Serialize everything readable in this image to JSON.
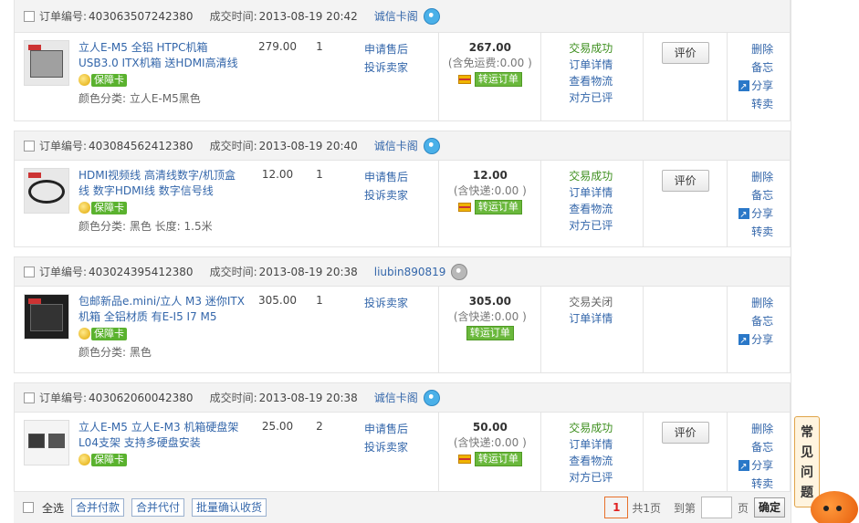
{
  "orders": [
    {
      "order_no_label": "订单编号:",
      "order_no": "403063507242380",
      "time_label": "成交时间:",
      "time": "2013-08-19 20:42",
      "seller": "诚信卡阁",
      "seller_online": true,
      "product": {
        "title": "立人E-M5 全铝 HTPC机箱 USB3.0 ITX机箱 送HDMI高清线",
        "badge": "保障卡",
        "attr": "颜色分类: 立人E-M5黑色"
      },
      "price": "279.00",
      "qty": "1",
      "service_links": [
        "申请售后",
        "投诉卖家"
      ],
      "total": "267.00",
      "shipping": "(含免运费:0.00 )",
      "convert_label": "转运订单",
      "status": "交易成功",
      "status_links": [
        "订单详情",
        "查看物流",
        "对方已评"
      ],
      "eval_label": "评价",
      "ops": [
        "删除",
        "备忘",
        "分享",
        "转卖"
      ]
    },
    {
      "order_no_label": "订单编号:",
      "order_no": "403084562412380",
      "time_label": "成交时间:",
      "time": "2013-08-19 20:40",
      "seller": "诚信卡阁",
      "seller_online": true,
      "product": {
        "title": "HDMI视频线 高清线数字/机顶盒线 数字HDMI线 数字信号线",
        "badge": "保障卡",
        "attr": "颜色分类: 黑色 长度: 1.5米"
      },
      "price": "12.00",
      "qty": "1",
      "service_links": [
        "申请售后",
        "投诉卖家"
      ],
      "total": "12.00",
      "shipping": "(含快递:0.00 )",
      "convert_label": "转运订单",
      "status": "交易成功",
      "status_links": [
        "订单详情",
        "查看物流",
        "对方已评"
      ],
      "eval_label": "评价",
      "ops": [
        "删除",
        "备忘",
        "分享",
        "转卖"
      ]
    },
    {
      "order_no_label": "订单编号:",
      "order_no": "403024395412380",
      "time_label": "成交时间:",
      "time": "2013-08-19 20:38",
      "seller": "liubin890819",
      "seller_online": false,
      "product": {
        "title": "包邮新品e.mini/立人 M3 迷你ITX机箱 全铝材质 有E-I5 I7 M5",
        "badge": "保障卡",
        "attr": "颜色分类: 黑色"
      },
      "price": "305.00",
      "qty": "1",
      "service_links": [
        "投诉卖家"
      ],
      "total": "305.00",
      "shipping": "(含快递:0.00 )",
      "convert_label": "转运订单",
      "status": "交易关闭",
      "status_links": [
        "订单详情"
      ],
      "eval_label": "",
      "ops": [
        "删除",
        "备忘",
        "分享"
      ]
    },
    {
      "order_no_label": "订单编号:",
      "order_no": "403062060042380",
      "time_label": "成交时间:",
      "time": "2013-08-19 20:38",
      "seller": "诚信卡阁",
      "seller_online": true,
      "product": {
        "title": "立人E-M5 立人E-M3 机箱硬盘架 L04支架 支持多硬盘安装",
        "badge": "保障卡",
        "attr": ""
      },
      "price": "25.00",
      "qty": "2",
      "service_links": [
        "申请售后",
        "投诉卖家"
      ],
      "total": "50.00",
      "shipping": "(含快递:0.00 )",
      "convert_label": "转运订单",
      "status": "交易成功",
      "status_links": [
        "订单详情",
        "查看物流",
        "对方已评"
      ],
      "eval_label": "评价",
      "ops": [
        "删除",
        "备忘",
        "分享",
        "转卖"
      ]
    }
  ],
  "bottom": {
    "select_all": "全选",
    "buttons": [
      "合并付款",
      "合并代付",
      "批量确认收货"
    ],
    "current_page": "1",
    "total_pages": "共1页",
    "goto_label": "到第",
    "page_unit": "页",
    "confirm": "确定"
  },
  "faq": {
    "label": "常见问题"
  }
}
